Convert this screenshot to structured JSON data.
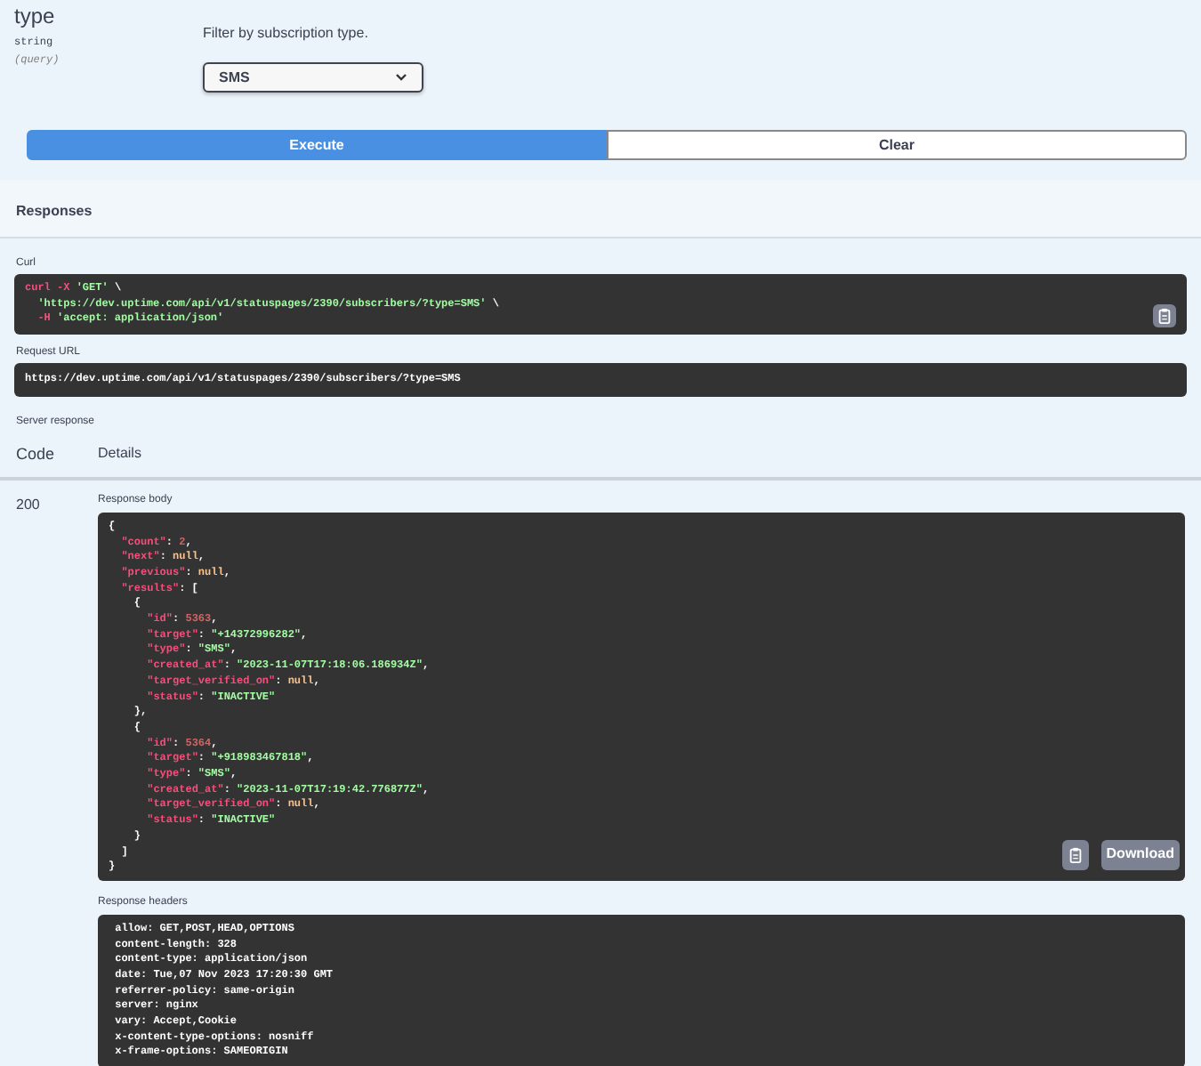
{
  "parameter": {
    "name": "type",
    "data_type": "string",
    "location": "(query)",
    "description": "Filter by subscription type.",
    "select": {
      "value": "SMS"
    }
  },
  "actions": [
    {
      "label": "Execute",
      "kind": "primary"
    },
    {
      "label": "Clear",
      "kind": "secondary"
    }
  ],
  "responses": {
    "title": "Responses",
    "curl": {
      "label": "Curl",
      "lines": [
        "curl -X 'GET' \\",
        "  'https://dev.uptime.com/api/v1/statuspages/2390/subscribers/?type=SMS' \\",
        "  -H 'accept: application/json'"
      ]
    },
    "request_url": {
      "label": "Request URL",
      "value": "https://dev.uptime.com/api/v1/statuspages/2390/subscribers/?type=SMS"
    },
    "server_response": {
      "label": "Server response",
      "columns": [
        "Code",
        "Details"
      ],
      "code": "200",
      "body": {
        "label": "Response body",
        "download": "Download",
        "lines": [
          "{",
          "  \"count\": 2,",
          "  \"next\": null,",
          "  \"previous\": null,",
          "  \"results\": [",
          "    {",
          "      \"id\": 5363,",
          "      \"target\": \"+14372996282\",",
          "      \"type\": \"SMS\",",
          "      \"created_at\": \"2023-11-07T17:18:06.186934Z\",",
          "      \"target_verified_on\": null,",
          "      \"status\": \"INACTIVE\"",
          "    },",
          "    {",
          "      \"id\": 5364,",
          "      \"target\": \"+918983467818\",",
          "      \"type\": \"SMS\",",
          "      \"created_at\": \"2023-11-07T17:19:42.776877Z\",",
          "      \"target_verified_on\": null,",
          "      \"status\": \"INACTIVE\"",
          "    }",
          "  ]",
          "}"
        ]
      },
      "headers": {
        "label": "Response headers",
        "lines": [
          " allow: GET,POST,HEAD,OPTIONS",
          " content-length: 328",
          " content-type: application/json",
          " date: Tue,07 Nov 2023 17:20:30 GMT",
          " referrer-policy: same-origin",
          " server: nginx",
          " vary: Accept,Cookie",
          " x-content-type-options: nosniff",
          " x-frame-options: SAMEORIGIN"
        ]
      }
    }
  }
}
